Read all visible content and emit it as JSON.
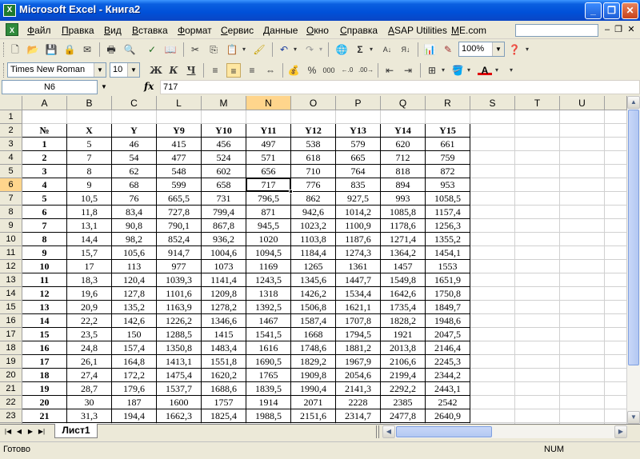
{
  "window": {
    "title": "Microsoft Excel - Книга2"
  },
  "menu": [
    "Файл",
    "Правка",
    "Вид",
    "Вставка",
    "Формат",
    "Сервис",
    "Данные",
    "Окно",
    "Справка",
    "ASAP Utilities",
    "ME.com"
  ],
  "help_placeholder": "",
  "toolbar": {
    "zoom": "100%",
    "font_name": "Times New Roman",
    "font_size": "10",
    "bold_label": "Ж",
    "italic_label": "К",
    "underline_label": "Ч",
    "percent_label": "%",
    "thousands_label": "000"
  },
  "formula_bar": {
    "name_box": "N6",
    "fx": "fx",
    "value": "717"
  },
  "columns": [
    "A",
    "B",
    "C",
    "L",
    "M",
    "N",
    "O",
    "P",
    "Q",
    "R",
    "S",
    "T",
    "U"
  ],
  "active_column": "N",
  "active_row": 6,
  "table": {
    "headers": [
      "№",
      "X",
      "Y",
      "Y9",
      "Y10",
      "Y11",
      "Y12",
      "Y13",
      "Y14",
      "Y15"
    ],
    "rows": [
      [
        "1",
        "5",
        "46",
        "415",
        "456",
        "497",
        "538",
        "579",
        "620",
        "661"
      ],
      [
        "2",
        "7",
        "54",
        "477",
        "524",
        "571",
        "618",
        "665",
        "712",
        "759"
      ],
      [
        "3",
        "8",
        "62",
        "548",
        "602",
        "656",
        "710",
        "764",
        "818",
        "872"
      ],
      [
        "4",
        "9",
        "68",
        "599",
        "658",
        "717",
        "776",
        "835",
        "894",
        "953"
      ],
      [
        "5",
        "10,5",
        "76",
        "665,5",
        "731",
        "796,5",
        "862",
        "927,5",
        "993",
        "1058,5"
      ],
      [
        "6",
        "11,8",
        "83,4",
        "727,8",
        "799,4",
        "871",
        "942,6",
        "1014,2",
        "1085,8",
        "1157,4"
      ],
      [
        "7",
        "13,1",
        "90,8",
        "790,1",
        "867,8",
        "945,5",
        "1023,2",
        "1100,9",
        "1178,6",
        "1256,3"
      ],
      [
        "8",
        "14,4",
        "98,2",
        "852,4",
        "936,2",
        "1020",
        "1103,8",
        "1187,6",
        "1271,4",
        "1355,2"
      ],
      [
        "9",
        "15,7",
        "105,6",
        "914,7",
        "1004,6",
        "1094,5",
        "1184,4",
        "1274,3",
        "1364,2",
        "1454,1"
      ],
      [
        "10",
        "17",
        "113",
        "977",
        "1073",
        "1169",
        "1265",
        "1361",
        "1457",
        "1553"
      ],
      [
        "11",
        "18,3",
        "120,4",
        "1039,3",
        "1141,4",
        "1243,5",
        "1345,6",
        "1447,7",
        "1549,8",
        "1651,9"
      ],
      [
        "12",
        "19,6",
        "127,8",
        "1101,6",
        "1209,8",
        "1318",
        "1426,2",
        "1534,4",
        "1642,6",
        "1750,8"
      ],
      [
        "13",
        "20,9",
        "135,2",
        "1163,9",
        "1278,2",
        "1392,5",
        "1506,8",
        "1621,1",
        "1735,4",
        "1849,7"
      ],
      [
        "14",
        "22,2",
        "142,6",
        "1226,2",
        "1346,6",
        "1467",
        "1587,4",
        "1707,8",
        "1828,2",
        "1948,6"
      ],
      [
        "15",
        "23,5",
        "150",
        "1288,5",
        "1415",
        "1541,5",
        "1668",
        "1794,5",
        "1921",
        "2047,5"
      ],
      [
        "16",
        "24,8",
        "157,4",
        "1350,8",
        "1483,4",
        "1616",
        "1748,6",
        "1881,2",
        "2013,8",
        "2146,4"
      ],
      [
        "17",
        "26,1",
        "164,8",
        "1413,1",
        "1551,8",
        "1690,5",
        "1829,2",
        "1967,9",
        "2106,6",
        "2245,3"
      ],
      [
        "18",
        "27,4",
        "172,2",
        "1475,4",
        "1620,2",
        "1765",
        "1909,8",
        "2054,6",
        "2199,4",
        "2344,2"
      ],
      [
        "19",
        "28,7",
        "179,6",
        "1537,7",
        "1688,6",
        "1839,5",
        "1990,4",
        "2141,3",
        "2292,2",
        "2443,1"
      ],
      [
        "20",
        "30",
        "187",
        "1600",
        "1757",
        "1914",
        "2071",
        "2228",
        "2385",
        "2542"
      ],
      [
        "21",
        "31,3",
        "194,4",
        "1662,3",
        "1825,4",
        "1988,5",
        "2151,6",
        "2314,7",
        "2477,8",
        "2640,9"
      ]
    ]
  },
  "sheet_tab": "Лист1",
  "status": {
    "text": "Готово",
    "num": "NUM"
  }
}
